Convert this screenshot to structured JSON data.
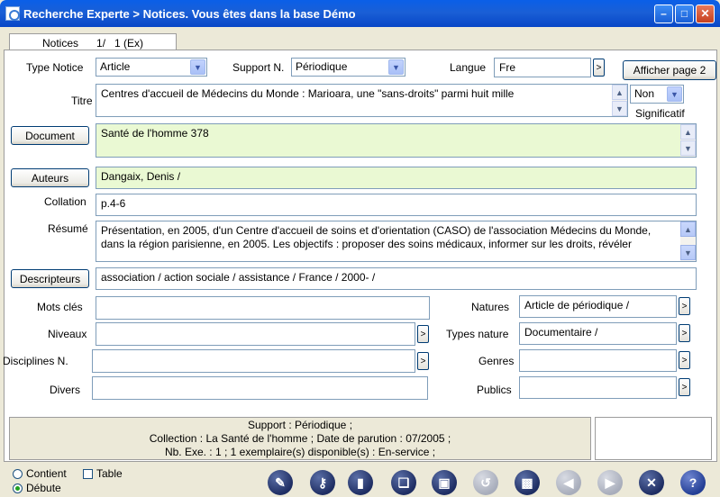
{
  "window": {
    "title": "Recherche Experte > Notices.  Vous êtes dans la base Démo"
  },
  "tab": {
    "label": "Notices",
    "counter": "1/   1 (Ex)"
  },
  "form": {
    "type_notice": {
      "label": "Type Notice",
      "value": "Article"
    },
    "support": {
      "label": "Support N.",
      "value": "Périodique"
    },
    "langue": {
      "label": "Langue",
      "value": "Fre"
    },
    "afficher_label": "Afficher page 2",
    "titre": {
      "label": "Titre",
      "value": "Centres d'accueil de Médecins du Monde : Marioara, une \"sans-droits\" parmi huit mille"
    },
    "significatif": {
      "value": "Non",
      "label": "Significatif"
    },
    "document": {
      "button": "Document",
      "value": "Santé de l'homme 378"
    },
    "auteurs": {
      "button": "Auteurs",
      "value": "Dangaix, Denis /"
    },
    "collation": {
      "label": "Collation",
      "value": "p.4-6"
    },
    "resume": {
      "label": "Résumé",
      "value": "Présentation, en 2005, d'un Centre d'accueil de soins et d'orientation (CASO) de l'association Médecins du Monde, dans la région parisienne, en 2005. Les objectifs : proposer des soins médicaux, informer sur les droits, révéler"
    },
    "descripteurs": {
      "button": "Descripteurs",
      "value": "association / action sociale / assistance / France / 2000- /"
    },
    "mots_cles": {
      "label": "Mots clés",
      "value": ""
    },
    "natures": {
      "label": "Natures",
      "value": "Article de périodique /"
    },
    "niveaux": {
      "label": "Niveaux",
      "value": ""
    },
    "types_nature": {
      "label": "Types nature",
      "value": "Documentaire /"
    },
    "disciplines": {
      "label": "Disciplines N.",
      "value": ""
    },
    "genres": {
      "label": "Genres",
      "value": ""
    },
    "divers": {
      "label": "Divers",
      "value": ""
    },
    "publics": {
      "label": "Publics",
      "value": ""
    },
    "more_glyph": ">"
  },
  "status": {
    "line1": "Support : Périodique ;",
    "line2": "Collection : La Santé de l'homme ;  Date de parution : 07/2005 ;",
    "line3": "Nb. Exe. : 1 ; 1 exemplaire(s) disponible(s) :  En-service ;"
  },
  "options": {
    "contient": "Contient",
    "table": "Table",
    "debute": "Débute",
    "selected": "Débute"
  },
  "toolbar": {
    "icons": [
      "edit-icon",
      "key-icon",
      "book-icon",
      "copy-icon",
      "save-icon",
      "undo-icon",
      "trash-icon",
      "prev-icon",
      "next-icon",
      "close-icon",
      "help-icon"
    ]
  }
}
